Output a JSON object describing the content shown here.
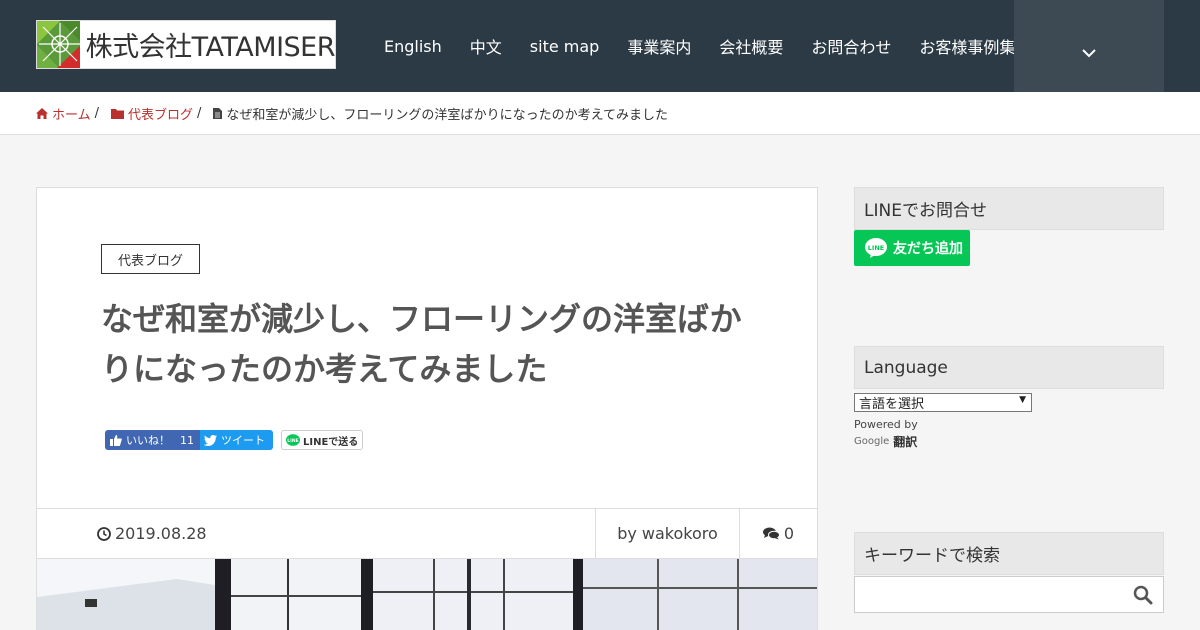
{
  "header": {
    "logo_text": "株式会社TATAMISER",
    "nav": [
      "English",
      "中文",
      "site map",
      "事業案内",
      "会社概要",
      "お問合わせ",
      "お客様事例集"
    ]
  },
  "breadcrumb": {
    "home": "ホーム",
    "category": "代表ブログ",
    "current": "なぜ和室が減少し、フローリングの洋室ばかりになったのか考えてみました"
  },
  "article": {
    "category_tag": "代表ブログ",
    "title": "なぜ和室が減少し、フローリングの洋室ばかりになったのか考えてみました",
    "share": {
      "fb_like": "いいね！",
      "fb_count": "11",
      "tweet": "ツイート",
      "line_send": "LINEで送る"
    },
    "meta": {
      "date": "2019.08.28",
      "author": "by wakokoro",
      "comments": "0"
    }
  },
  "sidebar": {
    "line_widget_title": "LINEでお問合せ",
    "line_button": "友だち追加",
    "language_title": "Language",
    "language_select": "言語を選択",
    "powered_by": "Powered by",
    "google": "Google",
    "translate": "翻訳",
    "search_title": "キーワードで検索"
  },
  "colors": {
    "header_bg": "#2b3a45",
    "accent_red": "#b8312f",
    "line_green": "#06c755",
    "facebook_blue": "#4267b2",
    "twitter_blue": "#1d9bf0"
  }
}
